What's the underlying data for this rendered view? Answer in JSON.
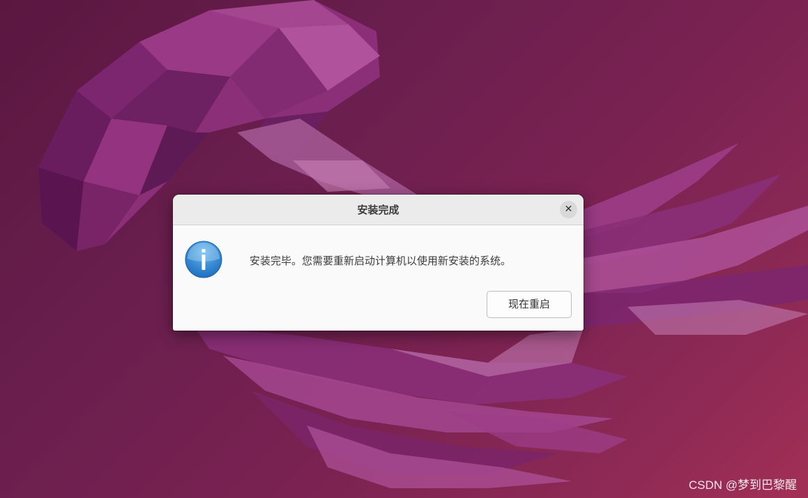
{
  "dialog": {
    "title": "安装完成",
    "close_icon": "close-icon",
    "info_icon": "info-icon",
    "message": "安装完毕。您需要重新启动计算机以使用新安装的系统。",
    "restart_button_label": "现在重启"
  },
  "watermark": "CSDN @梦到巴黎醒",
  "colors": {
    "wallpaper_base": "#6b1f4e",
    "dialog_background": "#fafafa",
    "titlebar_background": "#ebebeb",
    "info_icon_blue": "#2b86d4"
  }
}
